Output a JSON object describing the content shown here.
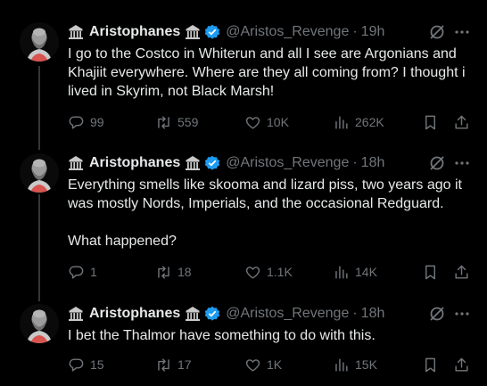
{
  "author": {
    "name": "Aristophanes",
    "handle": "@Aristos_Revenge",
    "dot": "·"
  },
  "tweets": [
    {
      "time": "19h",
      "text": "I go to the Costco in Whiterun and all I see are Argonians and Khajiit everywhere. Where are they all coming from? I thought i lived in Skyrim, not Black Marsh!",
      "replies": "99",
      "reposts": "559",
      "likes": "10K",
      "views": "262K"
    },
    {
      "time": "18h",
      "text": "Everything smells like skooma and lizard piss, two years ago it was mostly Nords, Imperials, and the occasional Redguard.\n\nWhat happened?",
      "replies": "1",
      "reposts": "18",
      "likes": "1.1K",
      "views": "14K"
    },
    {
      "time": "18h",
      "text": "I bet the Thalmor have something to do with this.",
      "replies": "15",
      "reposts": "17",
      "likes": "1K",
      "views": "15K"
    }
  ],
  "colors": {
    "background": "#000000",
    "text": "#e7e9ea",
    "muted": "#71767b",
    "verified": "#1d9bf0",
    "thread_line": "#333639"
  },
  "icons": [
    "temple-emoji-icon",
    "verified-badge-icon",
    "grok-icon",
    "more-icon",
    "reply-icon",
    "repost-icon",
    "like-icon",
    "views-icon",
    "bookmark-icon",
    "share-icon"
  ]
}
